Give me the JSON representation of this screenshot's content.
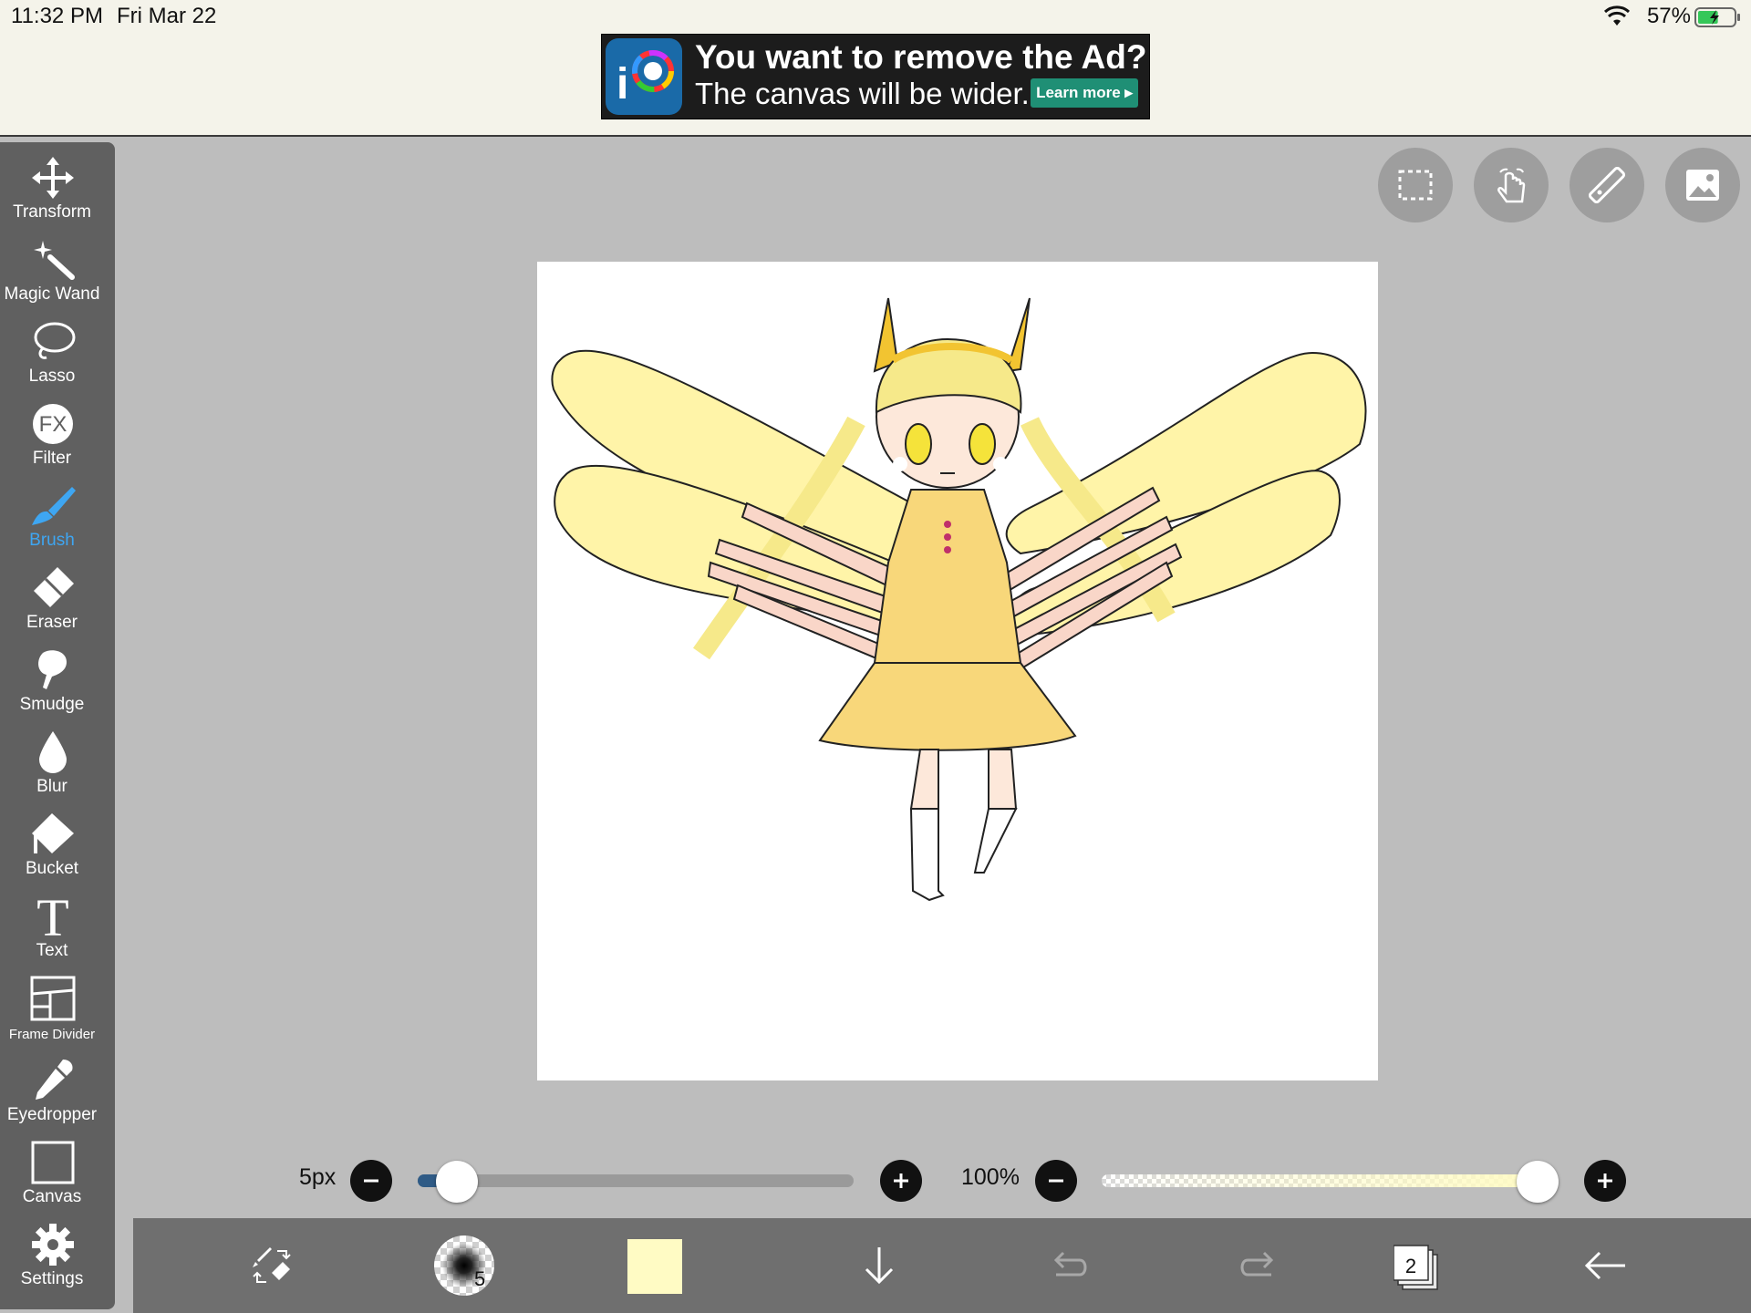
{
  "status_bar": {
    "time": "11:32 PM",
    "date": "Fri Mar 22",
    "battery": "57%",
    "battery_level": 0.57
  },
  "ad": {
    "title": "You want to remove the Ad?",
    "subtitle": "The canvas will be wider.",
    "button": "Learn more"
  },
  "tools": [
    {
      "label": "Transform",
      "icon": "move-arrows-icon"
    },
    {
      "label": "Magic Wand",
      "icon": "magic-wand-icon"
    },
    {
      "label": "Lasso",
      "icon": "lasso-icon"
    },
    {
      "label": "Filter",
      "icon": "fx-icon"
    },
    {
      "label": "Brush",
      "icon": "brush-icon",
      "active": true
    },
    {
      "label": "Eraser",
      "icon": "eraser-icon"
    },
    {
      "label": "Smudge",
      "icon": "smudge-icon"
    },
    {
      "label": "Blur",
      "icon": "drop-icon"
    },
    {
      "label": "Bucket",
      "icon": "bucket-icon"
    },
    {
      "label": "Text",
      "icon": "text-icon"
    },
    {
      "label": "Frame Divider",
      "icon": "frame-divider-icon"
    },
    {
      "label": "Eyedropper",
      "icon": "eyedropper-icon"
    },
    {
      "label": "Canvas",
      "icon": "canvas-icon"
    },
    {
      "label": "Settings",
      "icon": "gear-icon"
    }
  ],
  "top_buttons": [
    "selection-icon",
    "hand-icon",
    "ruler-icon",
    "image-icon"
  ],
  "brush_size": {
    "label": "5px",
    "value": 5,
    "fraction": 0.09
  },
  "opacity": {
    "label": "100%",
    "value": 100,
    "fraction": 1.0
  },
  "bottom": {
    "brush_number": "5",
    "layer_count": "2",
    "color": "#fffbc4"
  },
  "colors": {
    "accent": "#3ea6f2",
    "toolbar": "#606060",
    "background": "#bdbdbd"
  }
}
